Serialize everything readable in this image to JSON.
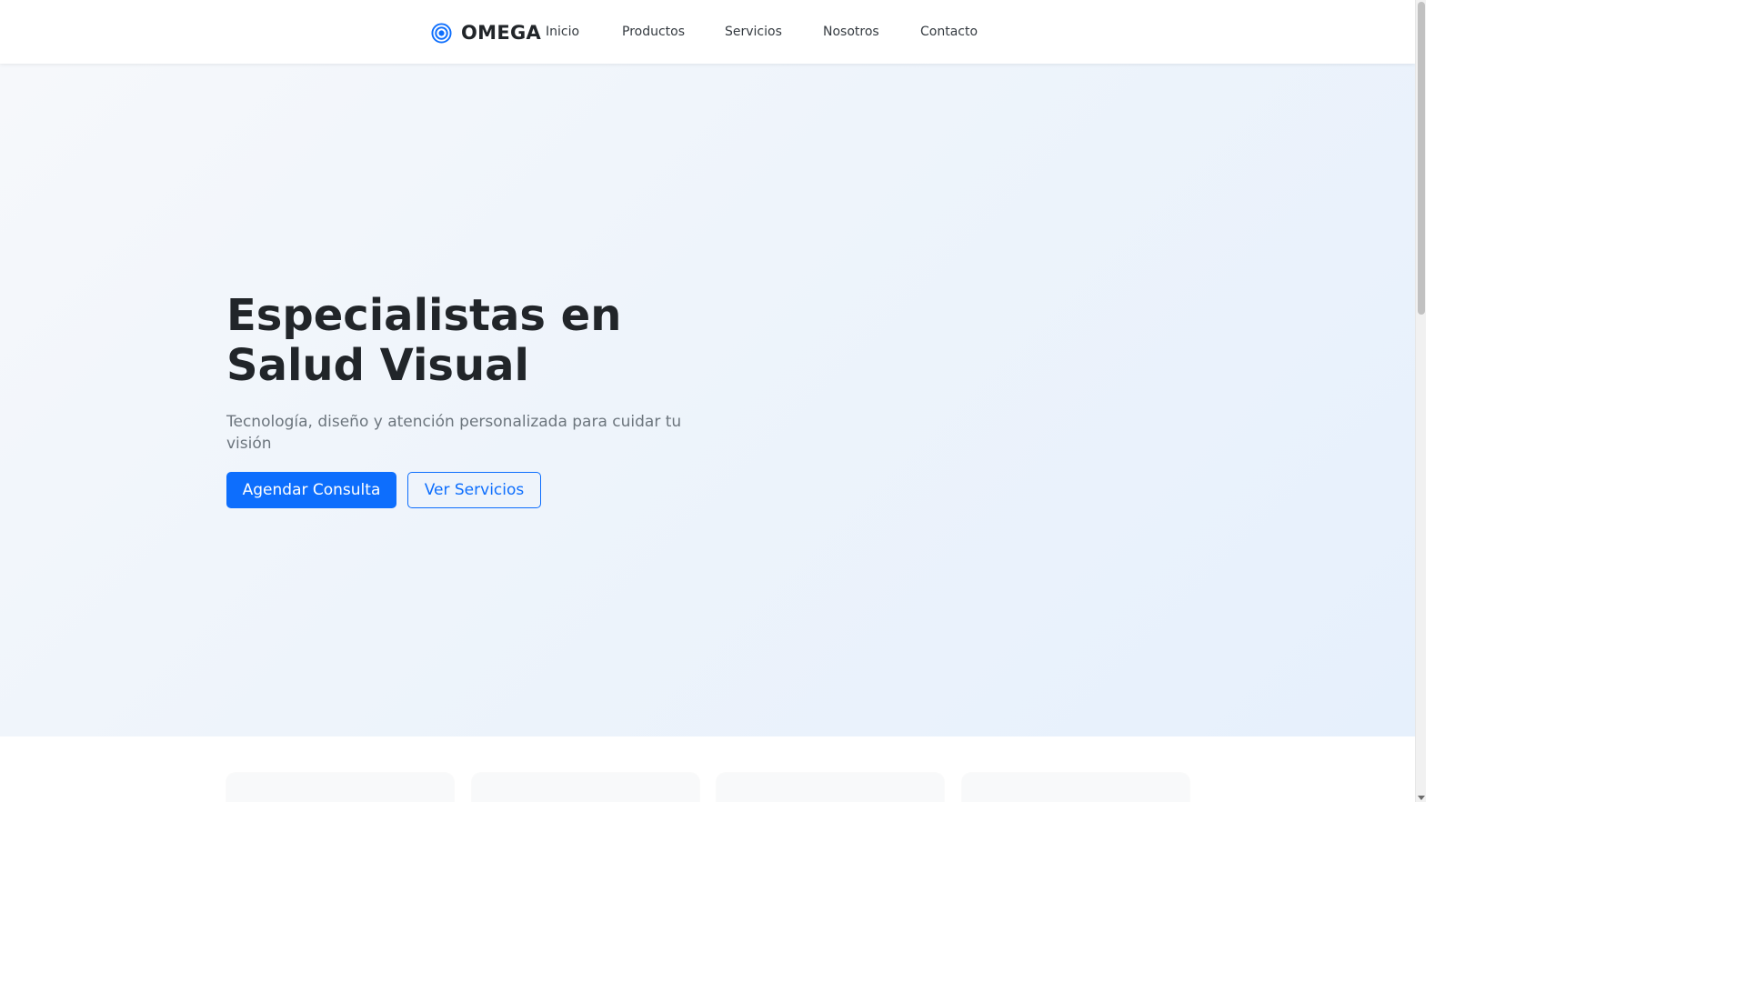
{
  "brand": {
    "name": "OMEGA",
    "icon": "target-icon",
    "accent_color": "#0d6efd"
  },
  "nav": {
    "items": [
      {
        "label": "Inicio"
      },
      {
        "label": "Productos"
      },
      {
        "label": "Servicios"
      },
      {
        "label": "Nosotros"
      },
      {
        "label": "Contacto"
      }
    ]
  },
  "hero": {
    "title_line1": "Especialistas en",
    "title_line2": "Salud Visual",
    "subtitle": "Tecnología, diseño y atención personalizada para cuidar tu visión",
    "primary_button": "Agendar Consulta",
    "secondary_button": "Ver Servicios"
  },
  "colors": {
    "primary": "#0d6efd",
    "text_dark": "#212529",
    "text_muted": "#6c757d",
    "hero_bg": "#eef4fb"
  }
}
